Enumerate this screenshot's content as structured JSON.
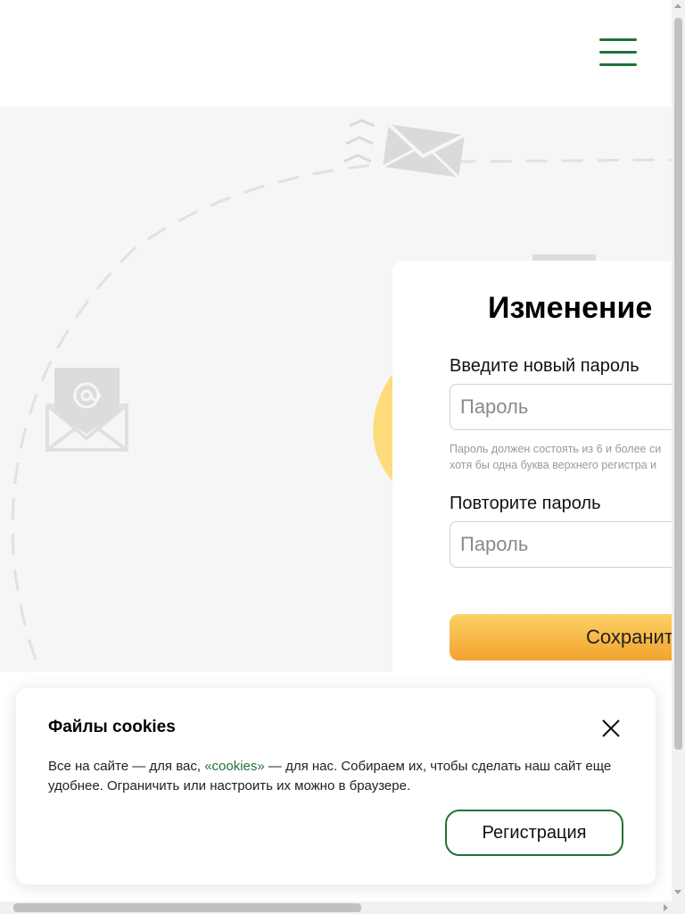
{
  "header": {
    "menu_icon": "hamburger-menu-icon",
    "accent_color": "#21723a"
  },
  "hero": {
    "decorations": [
      "envelope-icon",
      "at-sign-envelope-icon",
      "dashed-flight-path"
    ]
  },
  "form": {
    "title": "Изменение",
    "new_password_label": "Введите новый пароль",
    "new_password_placeholder": "Пароль",
    "hint_line1": "Пароль должен состоять из 6 и более си",
    "hint_line2": "хотя бы одна буква верхнего регистра и",
    "repeat_password_label": "Повторите пароль",
    "repeat_password_placeholder": "Пароль",
    "save_label": "Сохранит"
  },
  "cookie": {
    "title": "Файлы cookies",
    "text_before": "Все на сайте — для вас, ",
    "link_text": "«cookies»",
    "text_after": " — для нас. Собираем их, чтобы сделать наш сайт еще удобнее. Ограничить или настроить их можно в браузере.",
    "button_label": "Регистрация",
    "close_icon": "close-icon"
  }
}
